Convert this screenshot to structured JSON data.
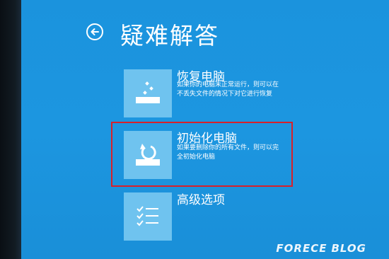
{
  "window": {
    "title": "疑难解答"
  },
  "options": [
    {
      "title": "恢复电脑",
      "description_lines": [
        "如果你的电脑未正常运行，则可以在",
        "不丢失文件的情况下对它进行恢复"
      ],
      "icon": "drive-sparkle-icon"
    },
    {
      "title": "初始化电脑",
      "description_lines": [
        "如果要删除你的所有文件，则可以完",
        "全初始化电脑"
      ],
      "icon": "drive-refresh-icon"
    },
    {
      "title": "高级选项",
      "description_lines": [],
      "icon": "checklist-icon"
    }
  ],
  "watermark": {
    "part1": "FORECE",
    "part2": "BLOG"
  },
  "colors": {
    "screen_bg": "#1c96e0",
    "tile_bg": "#6fc3ef",
    "highlight": "#d8202a",
    "text": "#ffffff"
  }
}
